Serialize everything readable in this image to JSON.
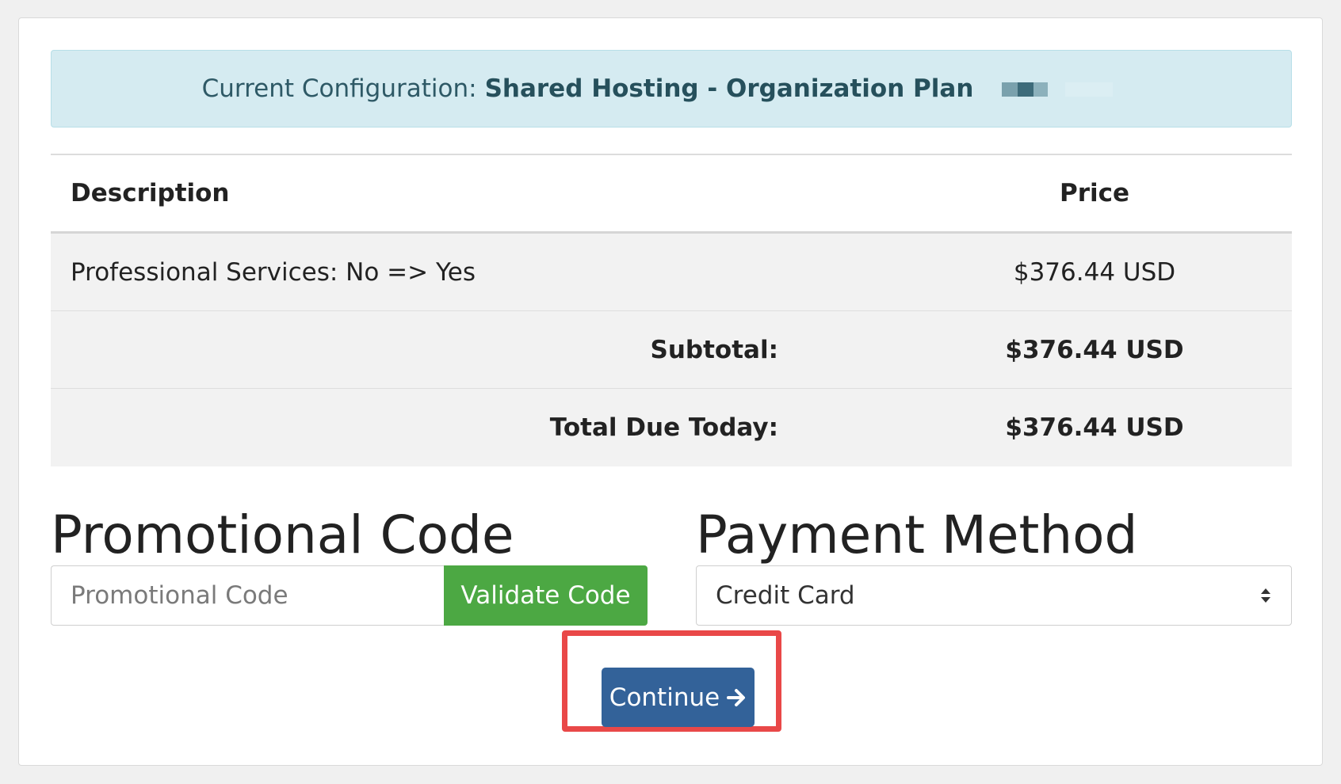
{
  "alert": {
    "label": "Current Configuration:",
    "plan": "Shared Hosting - Organization Plan"
  },
  "table": {
    "headers": {
      "description": "Description",
      "price": "Price"
    },
    "items": [
      {
        "description": "Professional Services: No => Yes",
        "price": "$376.44 USD"
      }
    ],
    "subtotal": {
      "label": "Subtotal:",
      "value": "$376.44 USD"
    },
    "total": {
      "label": "Total Due Today:",
      "value": "$376.44 USD"
    }
  },
  "promo": {
    "title": "Promotional Code",
    "placeholder": "Promotional Code",
    "value": "",
    "validate_label": "Validate Code"
  },
  "payment": {
    "title": "Payment Method",
    "selected": "Credit Card"
  },
  "actions": {
    "continue_label": "Continue"
  },
  "colors": {
    "alert_bg": "#d5ebf1",
    "validate_btn": "#4ca843",
    "continue_btn": "#336299",
    "highlight_border": "#e94848"
  },
  "icons": {
    "continue": "arrow-right-icon",
    "select": "select-arrows-icon"
  }
}
